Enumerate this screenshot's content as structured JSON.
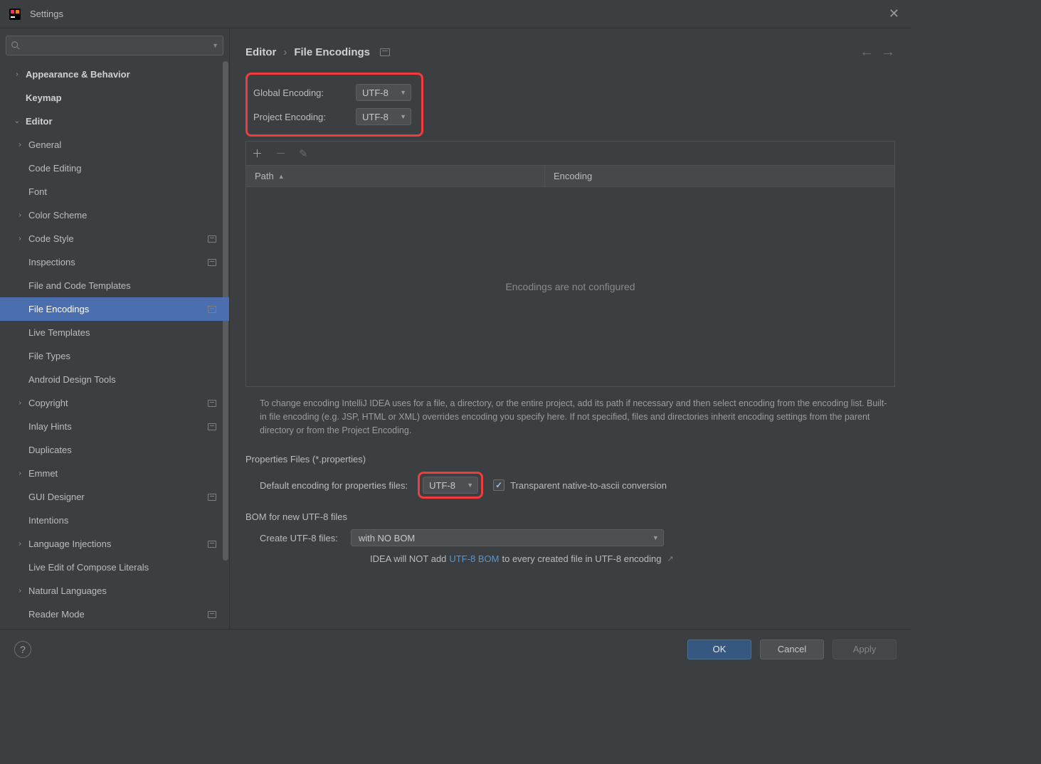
{
  "window": {
    "title": "Settings"
  },
  "search": {
    "placeholder": ""
  },
  "sidebar": {
    "items": [
      {
        "label": "Appearance & Behavior",
        "expandable": true,
        "bold": true,
        "depth": 0
      },
      {
        "label": "Keymap",
        "expandable": false,
        "bold": true,
        "depth": 0
      },
      {
        "label": "Editor",
        "expandable": true,
        "expanded": true,
        "bold": true,
        "depth": 0
      },
      {
        "label": "General",
        "expandable": true,
        "depth": 1
      },
      {
        "label": "Code Editing",
        "expandable": false,
        "depth": 1
      },
      {
        "label": "Font",
        "expandable": false,
        "depth": 1
      },
      {
        "label": "Color Scheme",
        "expandable": true,
        "depth": 1
      },
      {
        "label": "Code Style",
        "expandable": true,
        "depth": 1,
        "sub": true
      },
      {
        "label": "Inspections",
        "expandable": false,
        "depth": 1,
        "sub": true
      },
      {
        "label": "File and Code Templates",
        "expandable": false,
        "depth": 1
      },
      {
        "label": "File Encodings",
        "expandable": false,
        "depth": 1,
        "selected": true,
        "sub": true
      },
      {
        "label": "Live Templates",
        "expandable": false,
        "depth": 1
      },
      {
        "label": "File Types",
        "expandable": false,
        "depth": 1
      },
      {
        "label": "Android Design Tools",
        "expandable": false,
        "depth": 1
      },
      {
        "label": "Copyright",
        "expandable": true,
        "depth": 1,
        "sub": true
      },
      {
        "label": "Inlay Hints",
        "expandable": false,
        "depth": 1,
        "sub": true
      },
      {
        "label": "Duplicates",
        "expandable": false,
        "depth": 1
      },
      {
        "label": "Emmet",
        "expandable": true,
        "depth": 1
      },
      {
        "label": "GUI Designer",
        "expandable": false,
        "depth": 1,
        "sub": true
      },
      {
        "label": "Intentions",
        "expandable": false,
        "depth": 1
      },
      {
        "label": "Language Injections",
        "expandable": true,
        "depth": 1,
        "sub": true
      },
      {
        "label": "Live Edit of Compose Literals",
        "expandable": false,
        "depth": 1
      },
      {
        "label": "Natural Languages",
        "expandable": true,
        "depth": 1
      },
      {
        "label": "Reader Mode",
        "expandable": false,
        "depth": 1,
        "sub": true
      }
    ]
  },
  "breadcrumb": {
    "parent": "Editor",
    "current": "File Encodings"
  },
  "encoding": {
    "global_label": "Global Encoding:",
    "global_value": "UTF-8",
    "project_label": "Project Encoding:",
    "project_value": "UTF-8"
  },
  "table": {
    "col_path": "Path",
    "col_encoding": "Encoding",
    "empty_text": "Encodings are not configured"
  },
  "help_text": "To change encoding IntelliJ IDEA uses for a file, a directory, or the entire project, add its path if necessary and then select encoding from the encoding list. Built-in file encoding (e.g. JSP, HTML or XML) overrides encoding you specify here. If not specified, files and directories inherit encoding settings from the parent directory or from the Project Encoding.",
  "properties": {
    "section": "Properties Files (*.properties)",
    "default_label": "Default encoding for properties files:",
    "default_value": "UTF-8",
    "checkbox_label": "Transparent native-to-ascii conversion",
    "checked": true
  },
  "bom": {
    "section": "BOM for new UTF-8 files",
    "create_label": "Create UTF-8 files:",
    "create_value": "with NO BOM",
    "note_prefix": "IDEA will NOT add ",
    "note_link": "UTF-8 BOM",
    "note_suffix": " to every created file in UTF-8 encoding"
  },
  "buttons": {
    "ok": "OK",
    "cancel": "Cancel",
    "apply": "Apply"
  }
}
